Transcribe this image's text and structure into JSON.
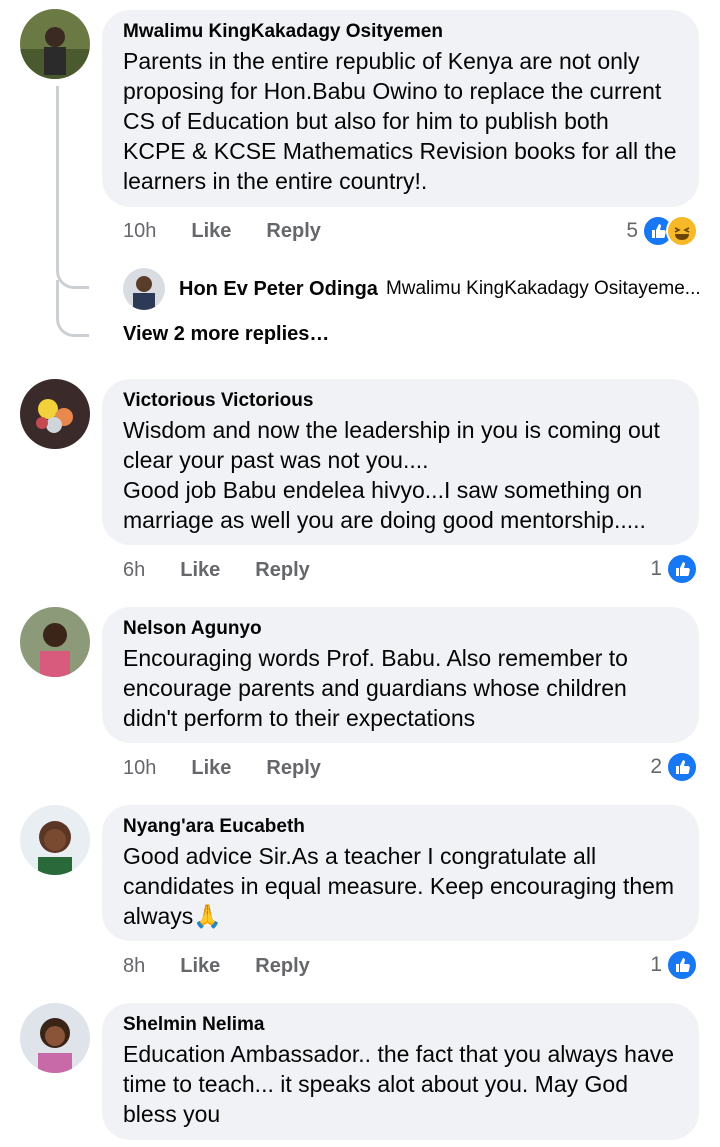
{
  "comments": [
    {
      "author": "Mwalimu KingKakadagy Osityemen",
      "text": "Parents in the entire republic of Kenya are not only proposing for Hon.Babu Owino to replace the current CS of Education but also for him to publish both KCPE & KCSE Mathematics Revision books for all the learners in the entire country!.",
      "time": "10h",
      "like": "Like",
      "reply": "Reply",
      "reactions": "5",
      "reaction_icons": [
        "like-icon",
        "haha-icon"
      ]
    },
    {
      "author": "Victorious Victorious",
      "text": "Wisdom and now the leadership in you is coming out clear your past was not you....\nGood job Babu endelea hivyo...I saw something on marriage as well you are doing good mentorship.....",
      "time": "6h",
      "like": "Like",
      "reply": "Reply",
      "reactions": "1",
      "reaction_icons": [
        "like-icon"
      ]
    },
    {
      "author": "Nelson Agunyo",
      "text": "Encouraging words Prof. Babu. Also remember to encourage parents and guardians whose children didn't perform to their expectations",
      "time": "10h",
      "like": "Like",
      "reply": "Reply",
      "reactions": "2",
      "reaction_icons": [
        "like-icon"
      ]
    },
    {
      "author": "Nyang'ara Eucabeth",
      "text": "Good advice Sir.As a teacher I congratulate all candidates in equal measure. Keep encouraging them always🙏",
      "time": "8h",
      "like": "Like",
      "reply": "Reply",
      "reactions": "1",
      "reaction_icons": [
        "like-icon"
      ]
    },
    {
      "author": "Shelmin Nelima",
      "text": "Education Ambassador.. the fact that you always have time to teach... it speaks alot about you. May God bless you"
    }
  ],
  "reply_preview": {
    "author": "Hon Ev Peter Odinga",
    "text": "Mwalimu KingKakadagy Ositayeme..."
  },
  "view_more": "View 2 more replies…",
  "colors": {
    "bubble": "#f0f2f5",
    "like_blue": "#1877f2",
    "meta_gray": "#65676b"
  }
}
